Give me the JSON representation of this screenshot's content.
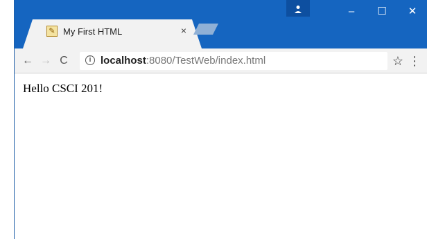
{
  "tab": {
    "title": "My First HTML",
    "close": "×",
    "favicon": "html-file-icon"
  },
  "window_controls": {
    "profile": "profile-icon",
    "minimize": "–",
    "maximize": "☐",
    "close": "✕"
  },
  "toolbar": {
    "back": "←",
    "forward": "→",
    "reload": "C",
    "info": "i",
    "url_host": "localhost",
    "url_rest": ":8080/TestWeb/index.html",
    "bookmark": "☆",
    "menu": "⋮"
  },
  "page": {
    "text": "Hello CSCI 201!"
  },
  "colors": {
    "titlebar": "#1565c0",
    "tab_bg": "#f2f2f2"
  }
}
